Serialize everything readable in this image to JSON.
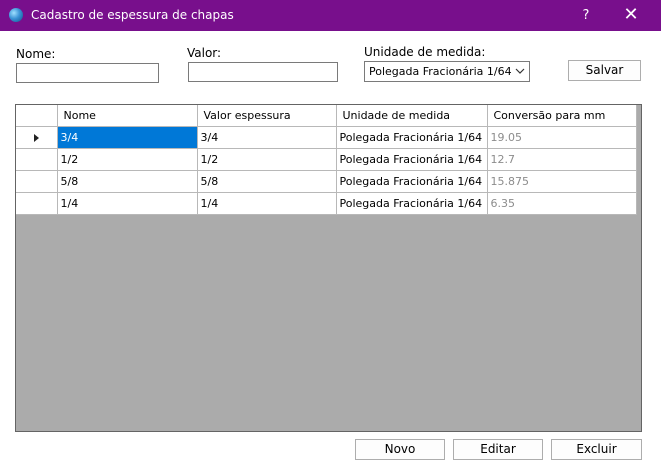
{
  "window": {
    "title": "Cadastro de espessura de chapas",
    "help_label": "?",
    "close_label": "✕"
  },
  "form": {
    "nome_label": "Nome:",
    "nome_value": "",
    "valor_label": "Valor:",
    "valor_value": "",
    "unidade_label": "Unidade de medida:",
    "unidade_selected": "Polegada Fracionária 1/64",
    "salvar_label": "Salvar"
  },
  "grid": {
    "columns": [
      "Nome",
      "Valor espessura",
      "Unidade de medida",
      "Conversão para mm"
    ],
    "rows": [
      {
        "nome": "3/4",
        "valor": "3/4",
        "unidade": "Polegada Fracionária 1/64",
        "conversao": "19.05"
      },
      {
        "nome": "1/2",
        "valor": "1/2",
        "unidade": "Polegada Fracionária 1/64",
        "conversao": "12.7"
      },
      {
        "nome": "5/8",
        "valor": "5/8",
        "unidade": "Polegada Fracionária 1/64",
        "conversao": "15.875"
      },
      {
        "nome": "1/4",
        "valor": "1/4",
        "unidade": "Polegada Fracionária 1/64",
        "conversao": "6.35"
      }
    ],
    "current_row": 0,
    "selection_color": "#0078d7"
  },
  "footer": {
    "novo_label": "Novo",
    "editar_label": "Editar",
    "excluir_label": "Excluir"
  },
  "theme": {
    "titlebar_color": "#780f8c",
    "grid_background": "#ababab"
  }
}
